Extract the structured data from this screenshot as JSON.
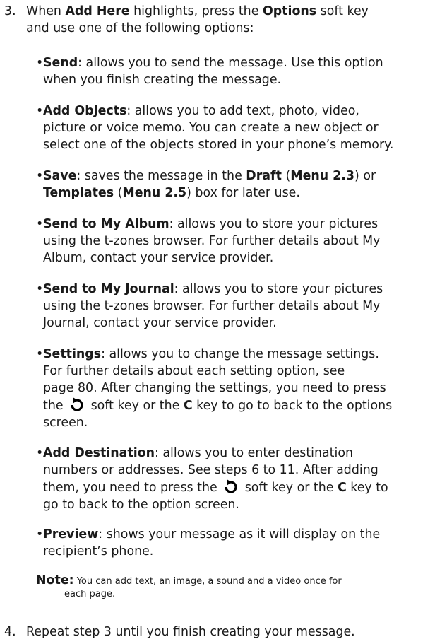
{
  "step3": {
    "num": "3.",
    "intro_a": "When ",
    "intro_b1": "Add Here",
    "intro_c": " highlights, press the ",
    "intro_b2": "Options",
    "intro_d": " soft key",
    "intro_e": "and use one of the following options:"
  },
  "options": [
    {
      "title": "Send",
      "desc": ": allows you to send the message. Use this option",
      "desc2": "when you finish creating the message."
    },
    {
      "title": "Add Objects",
      "desc": ": allows you to add text, photo, video,",
      "desc2": "picture or voice memo. You can create a new object or",
      "desc3": "select one of the objects stored in your phone’s memory."
    },
    {
      "title": "Save",
      "desc": ": saves the message in the ",
      "b1": "Draft",
      "d2": " (",
      "b2": "Menu 2.3",
      "d3": ") or",
      "b3": "Templates",
      "d4": " (",
      "b4": "Menu 2.5",
      "d5": ") box for later use."
    },
    {
      "title": "Send to My Album",
      "desc": ": allows you to store your pictures",
      "desc2": "using the t-zones browser. For further details about My",
      "desc3": "Album, contact your service provider."
    },
    {
      "title": "Send to My Journal",
      "desc": ": allows you to store your pictures",
      "desc2": "using the t-zones browser. For further details about My",
      "desc3": "Journal, contact your service provider."
    },
    {
      "title": "Settings",
      "desc": ": allows you to change the message settings.",
      "desc2": "For further details about each setting option, see",
      "desc3": "page 80. After changing the settings, you need to press",
      "desc4a": "the ",
      "desc4b": " soft key or the ",
      "ckey": "C",
      "desc4c": " key to go to back to the options",
      "desc5": "screen."
    },
    {
      "title": "Add Destination",
      "desc": ": allows you to enter destination",
      "desc2": "numbers or addresses. See steps 6 to 11. After adding",
      "desc3a": "them, you need to press the ",
      "desc3b": " soft key or the ",
      "ckey": "C",
      "desc3c": " key to",
      "desc4": "go to back to the option screen."
    },
    {
      "title": "Preview",
      "desc": ": shows your message as it will display on the",
      "desc2": "recipient’s phone."
    }
  ],
  "note": {
    "label": "Note:",
    "text": " You can add text, an image, a sound and a video once for",
    "text2": "each page."
  },
  "step4": {
    "num": "4.",
    "text": "Repeat step 3 until you finish creating your message."
  },
  "bullet_char": "•",
  "icon_name": "undo-arrow-icon"
}
